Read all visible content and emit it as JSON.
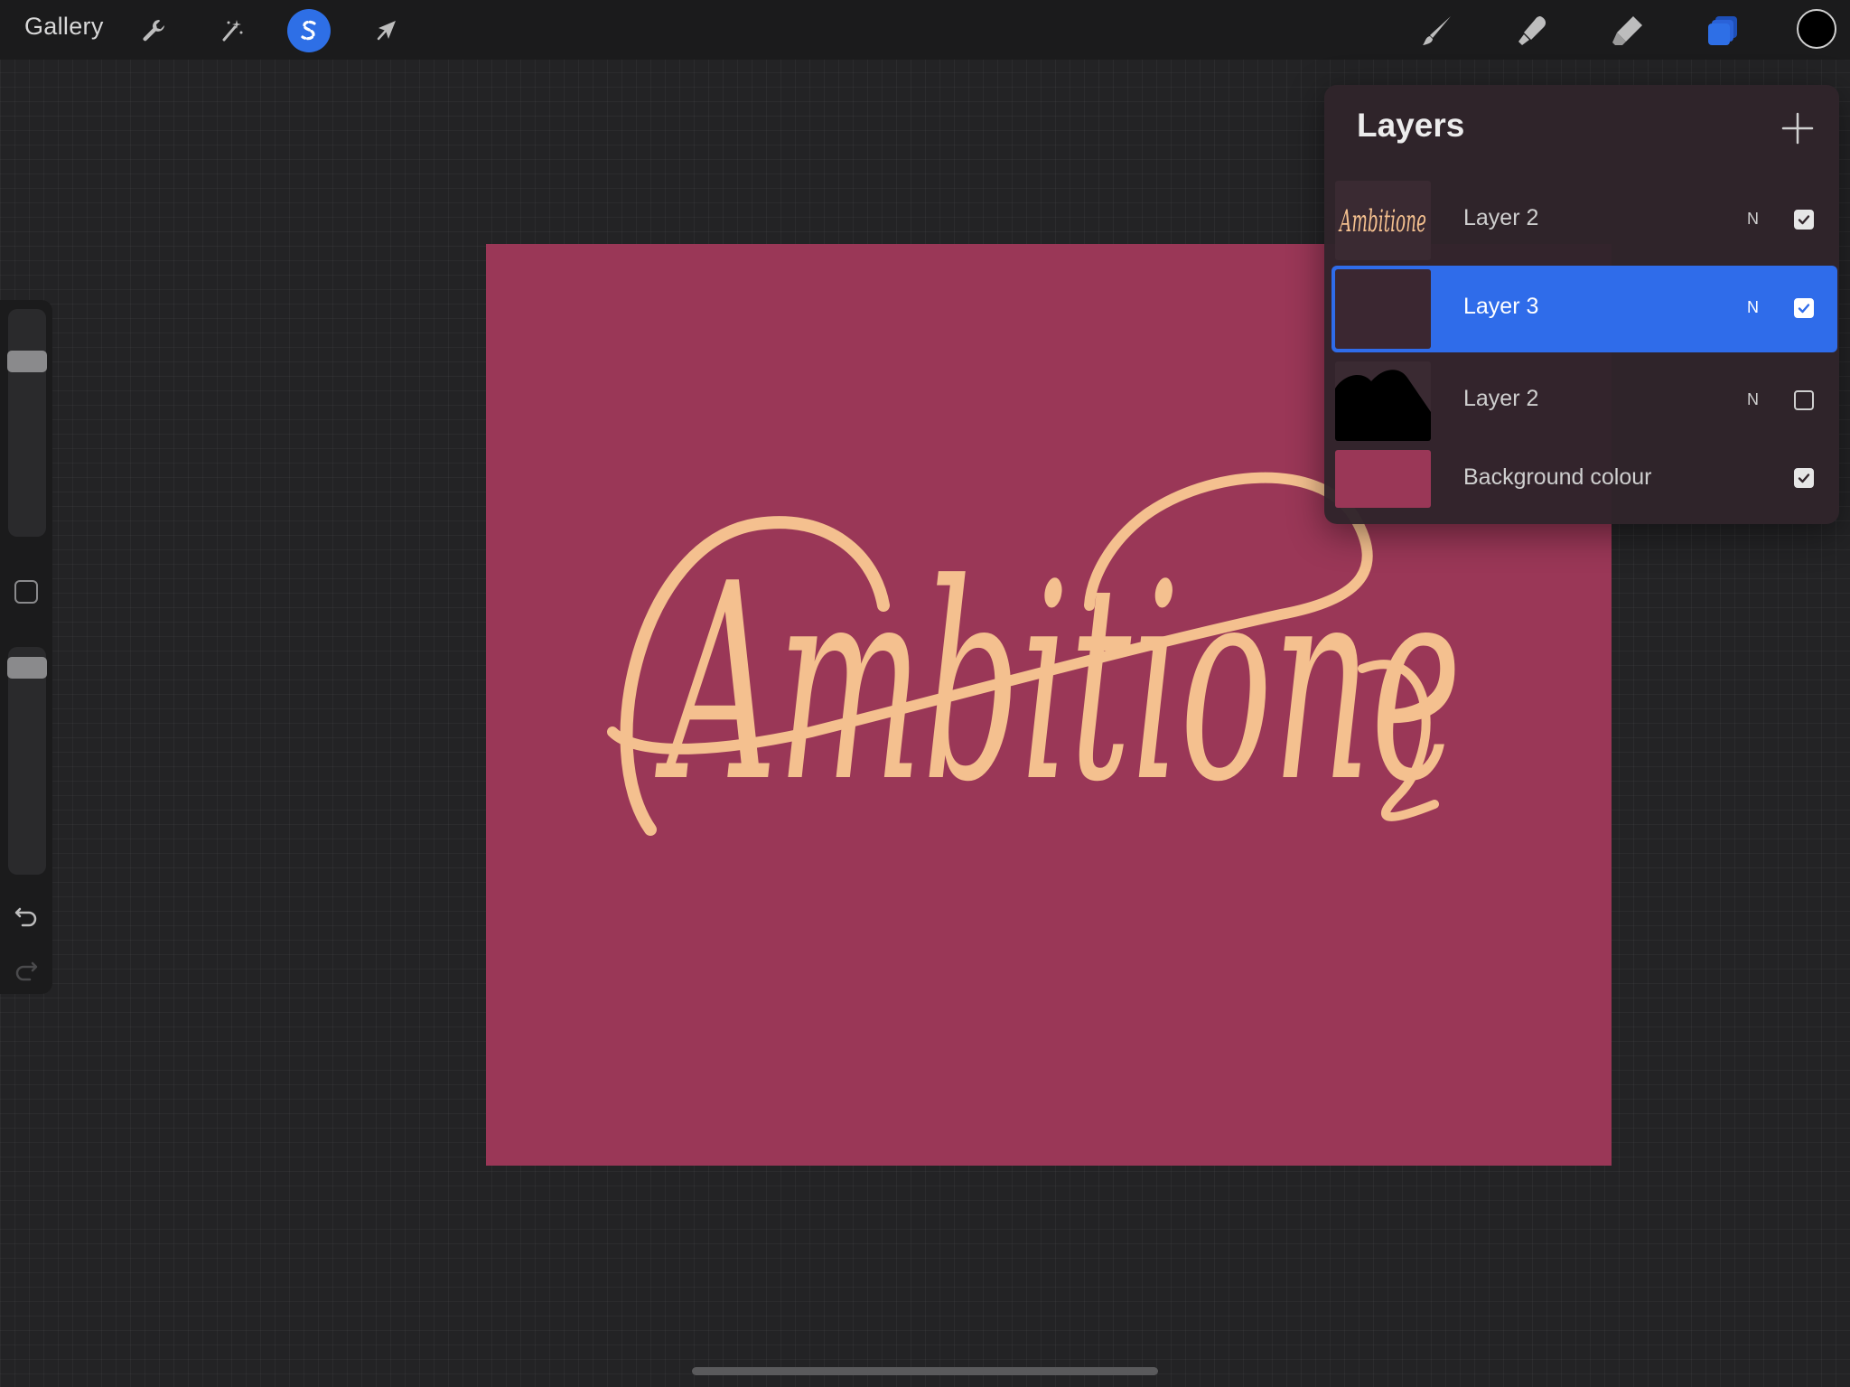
{
  "toolbar": {
    "gallery_label": "Gallery",
    "left_tools": [
      {
        "name": "actions",
        "icon": "wrench-icon"
      },
      {
        "name": "adjustments",
        "icon": "magic-wand-icon"
      },
      {
        "name": "selection",
        "icon": "selection-s-icon",
        "active": true
      },
      {
        "name": "transform",
        "icon": "arrow-cursor-icon"
      }
    ],
    "right_tools": [
      {
        "name": "paint",
        "icon": "brush-icon"
      },
      {
        "name": "smudge",
        "icon": "smudge-icon"
      },
      {
        "name": "erase",
        "icon": "eraser-icon"
      },
      {
        "name": "layers",
        "icon": "layers-icon",
        "active": true
      }
    ],
    "current_color": "#000000",
    "accent_color": "#2e6fe6"
  },
  "sidebar": {
    "brush_size_level": 0.8,
    "opacity_level": 0.95,
    "undo_icon": "undo-icon",
    "redo_icon": "redo-icon"
  },
  "canvas": {
    "background_color": "#9a3757",
    "artwork_text": "Ambitione",
    "lettering_color": "#f4c08f"
  },
  "layers_panel": {
    "title": "Layers",
    "add_icon": "plus-icon",
    "layers": [
      {
        "name": "Layer 2",
        "mode": "N",
        "visible": true,
        "selected": false
      },
      {
        "name": "Layer 3",
        "mode": "N",
        "visible": true,
        "selected": true
      },
      {
        "name": "Layer 2",
        "mode": "N",
        "visible": false,
        "selected": false
      },
      {
        "name": "Background colour",
        "mode": "",
        "visible": true,
        "selected": false
      }
    ]
  }
}
